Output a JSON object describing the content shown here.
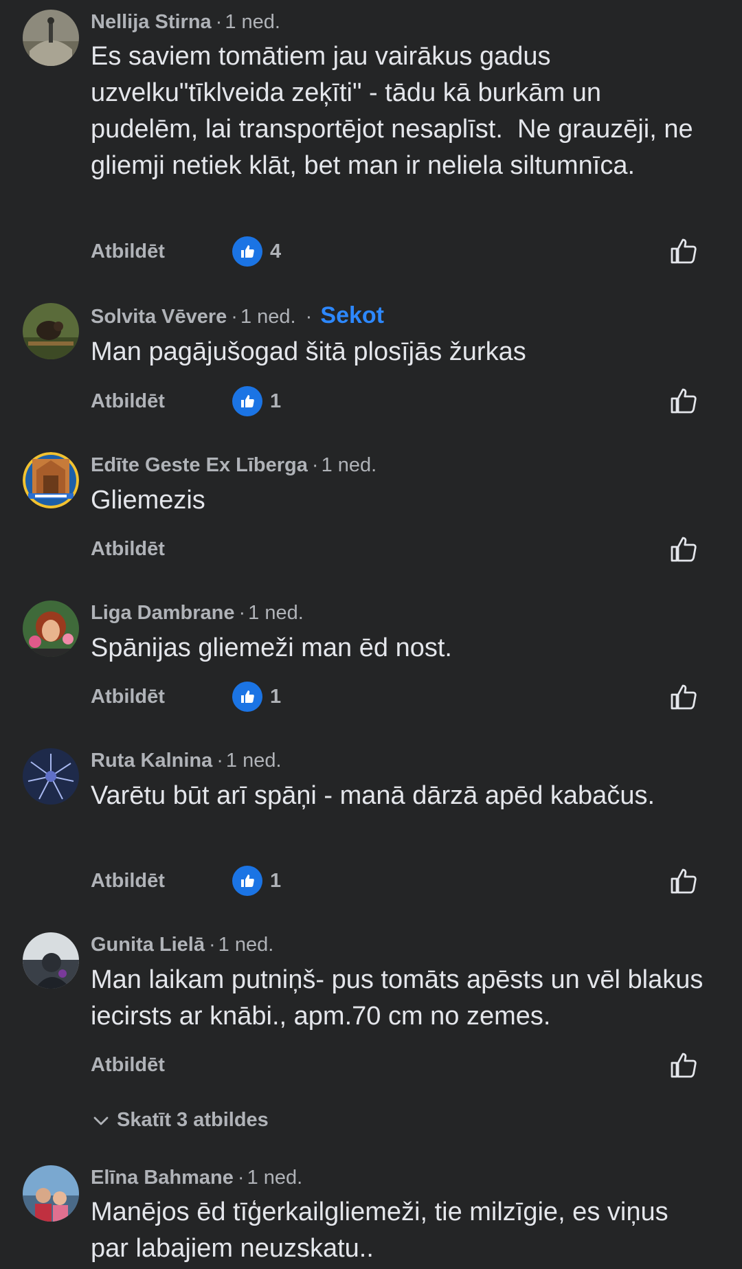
{
  "colors": {
    "background": "#242526",
    "text_primary": "#e4e6eb",
    "text_secondary": "#b0b3b8",
    "accent": "#2d88ff",
    "reaction_bubble": "#1b74e4"
  },
  "icons": {
    "like_reaction": "thumbs-up-filled-icon",
    "like_action": "thumbs-up-outline-icon",
    "expand": "chevron-down-icon"
  },
  "comments": [
    {
      "author": "Nellija Stirna",
      "time": "1 ned.",
      "text": "Es saviem tomātiem jau vairākus gadus uzvelku\"tīklveida zeķīti\" - tādu kā burkām un pudelēm, lai transportējot nesaplīst.  Ne grauzēji, ne gliemji netiek klāt, bet man ir neliela siltumnīca.",
      "reply_label": "Atbildēt",
      "reactions": "4"
    },
    {
      "author": "Solvita Vēvere",
      "time": "1 ned.",
      "follow_label": "Sekot",
      "text": "Man pagājušogad šitā plosījās žurkas",
      "reply_label": "Atbildēt",
      "reactions": "1"
    },
    {
      "author": "Edīte Geste Ex Līberga",
      "time": "1 ned.",
      "text": "Gliemezis",
      "reply_label": "Atbildēt",
      "reactions": null
    },
    {
      "author": "Liga Dambrane",
      "time": "1 ned.",
      "text": "Spānijas gliemeži man ēd nost.",
      "reply_label": "Atbildēt",
      "reactions": "1"
    },
    {
      "author": "Ruta Kalnina",
      "time": "1 ned.",
      "text": "Varētu būt arī spāņi - manā dārzā apēd kabačus.",
      "reply_label": "Atbildēt",
      "reactions": "1"
    },
    {
      "author": "Gunita Lielā",
      "time": "1 ned.",
      "text": "Man laikam putniņš- pus tomāts apēsts un vēl blakus iecirsts ar knābi., apm.70 cm no zemes.",
      "reply_label": "Atbildēt",
      "reactions": null,
      "view_replies_label": "Skatīt 3 atbildes"
    },
    {
      "author": "Elīna Bahmane",
      "time": "1 ned.",
      "text": "Manējos ēd tīģerkailgliemeži, tie milzīgie, es viņus par labajiem neuzskatu.."
    }
  ]
}
